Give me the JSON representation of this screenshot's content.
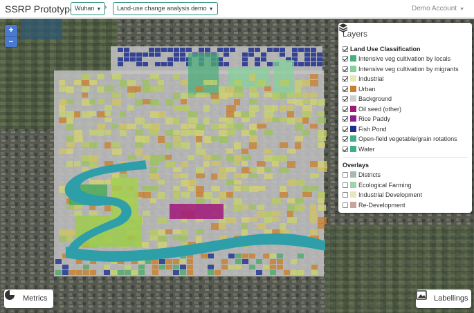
{
  "navbar": {
    "brand": "SSRP Prototype",
    "city": "Wuhan",
    "separator": "›",
    "demo": "Land-use change analysis demo",
    "account": "Demo Account"
  },
  "map": {
    "zoom_in": "+",
    "zoom_out": "−"
  },
  "layers": {
    "title": "Layers",
    "land_use_title": "Land Use Classification",
    "land_use": [
      {
        "label": "Intensive veg cultivation by locals",
        "color": "#4cae7a",
        "checked": true
      },
      {
        "label": "Intensive veg cultivation by migrants",
        "color": "#86d09b",
        "checked": true
      },
      {
        "label": "Industrial",
        "color": "#e8e8b4",
        "checked": true
      },
      {
        "label": "Urban",
        "color": "#c97f2b",
        "checked": true
      },
      {
        "label": "Background",
        "color": "#cfcfcf",
        "checked": true
      },
      {
        "label": "Oil seed (other)",
        "color": "#a0187a",
        "checked": true
      },
      {
        "label": "Rice Paddy",
        "color": "#8a1f8f",
        "checked": true
      },
      {
        "label": "Fish Pond",
        "color": "#1e2f8f",
        "checked": true
      },
      {
        "label": "Open-field vegetable/grain rotations",
        "color": "#3fae8a",
        "checked": true
      },
      {
        "label": "Water",
        "color": "#3bb08a",
        "checked": true
      }
    ],
    "overlays_title": "Overlays",
    "overlays": [
      {
        "label": "Districts",
        "color": "#a9b9b0",
        "checked": false
      },
      {
        "label": "Ecological Farming",
        "color": "#9fd3a8",
        "checked": false
      },
      {
        "label": "Industrial Development",
        "color": "#e6e6bf",
        "checked": false
      },
      {
        "label": "Re-Development",
        "color": "#c9a49a",
        "checked": false
      }
    ]
  },
  "buttons": {
    "metrics": "Metrics",
    "labellings": "Labellings"
  }
}
